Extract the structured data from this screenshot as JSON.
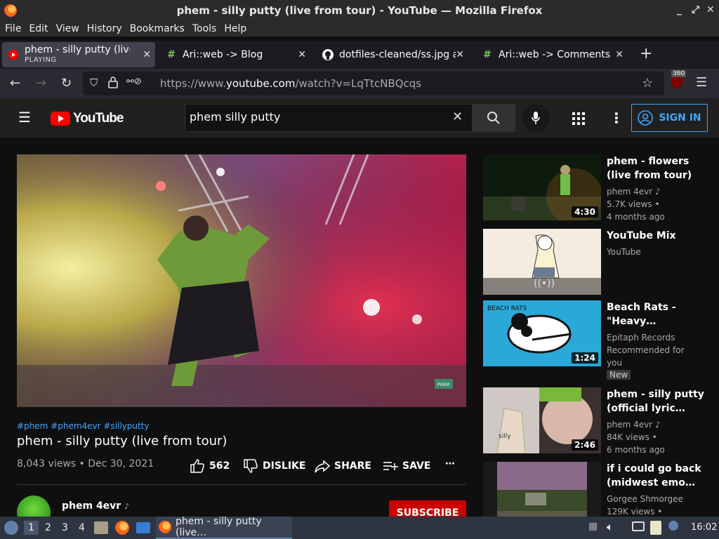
{
  "window": {
    "title": "phem - silly putty (live from tour) - YouTube — Mozilla Firefox",
    "controls": [
      "_",
      "⤢",
      "✕"
    ]
  },
  "menu": [
    "File",
    "Edit",
    "View",
    "History",
    "Bookmarks",
    "Tools",
    "Help"
  ],
  "tabs": [
    {
      "label": "phem - silly putty (live fr",
      "sub": "PLAYING",
      "icon": "youtube-icon",
      "active": true
    },
    {
      "label": "Ari::web -> Blog",
      "icon": "hashtag-icon",
      "active": false
    },
    {
      "label": "dotfiles-cleaned/ss.jpg at",
      "icon": "github-icon",
      "active": false
    },
    {
      "label": "Ari::web -> Comments",
      "icon": "hashtag-icon",
      "active": false
    }
  ],
  "new_tab": "+",
  "url": {
    "prefix": "https://www.",
    "domain": "youtube.com",
    "path": "/watch?v=LqTtcNBQcqs"
  },
  "ublock_badge": "360",
  "youtube": {
    "logo_text": "YouTube",
    "search_value": "phem silly putty",
    "sign_in": "SIGN IN"
  },
  "video": {
    "hashtags": "#phem #phem4evr #sillyputty",
    "title": "phem - silly putty (live from tour)",
    "meta": "8,043 views • Dec 30, 2021",
    "likes": "562",
    "dislike": "DISLIKE",
    "share": "SHARE",
    "save": "SAVE",
    "watermark": "PHEM"
  },
  "channel": {
    "name": "phem 4evr",
    "subscribe": "SUBSCRIBE"
  },
  "recommendations": [
    {
      "title": "phem - flowers (live from tour)",
      "channel": "phem 4evr",
      "views": "5.7K views •",
      "age": "4 months ago",
      "duration": "4:30"
    },
    {
      "title": "YouTube Mix",
      "channel": "YouTube",
      "views": "",
      "age": "",
      "duration": ""
    },
    {
      "title": "Beach Rats - \"Heavy…",
      "channel": "Epitaph Records",
      "views": "Recommended for",
      "age": "you",
      "badge": "New",
      "duration": "1:24",
      "thumb_text": "BEACH RATS"
    },
    {
      "title": "phem - silly putty (official lyric…",
      "channel": "phem 4evr",
      "views": "84K views •",
      "age": "6 months ago",
      "duration": "2:46"
    },
    {
      "title": "if i could go back (midwest emo…",
      "channel": "Gorgee Shmorgee",
      "views": "129K views •",
      "age": "",
      "duration": ""
    }
  ],
  "taskbar": {
    "workspaces": [
      "1",
      "2",
      "3",
      "4"
    ],
    "task_label": "phem - silly putty (live…",
    "clock": "16:02"
  },
  "colors": {
    "yt_red": "#ff0000",
    "link_blue": "#3ea6ff",
    "subscribe_red": "#cc0000"
  }
}
